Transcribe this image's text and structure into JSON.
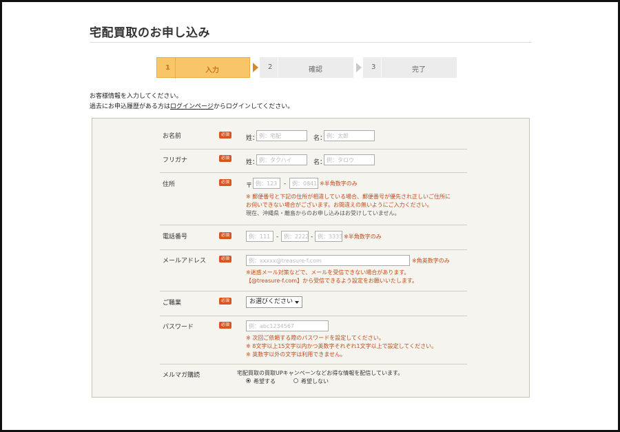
{
  "page": {
    "title": "宅配買取のお申し込み"
  },
  "steps": [
    {
      "num": "1",
      "label": "入力"
    },
    {
      "num": "2",
      "label": "確認"
    },
    {
      "num": "3",
      "label": "完了"
    }
  ],
  "intro": {
    "line1": "お客様情報を入力してください。",
    "line2_pre": "過去にお申込履歴がある方は",
    "login_link": "ログインページ",
    "line2_post": "からログインしてください。"
  },
  "required_badge": "必須",
  "form": {
    "name": {
      "label": "お名前",
      "sei": "姓：",
      "sei_placeholder": "例：宅配",
      "mei": "名：",
      "mei_placeholder": "例：太郎"
    },
    "kana": {
      "label": "フリガナ",
      "sei": "姓：",
      "sei_placeholder": "例：タクハイ",
      "mei": "名：",
      "mei_placeholder": "例：タロウ"
    },
    "address": {
      "label": "住所",
      "postal_mark": "〒",
      "zip1_placeholder": "例：123",
      "dash": "-",
      "zip2_placeholder": "例：0841",
      "hint": "※半角数字のみ",
      "notes": [
        "※ 郵便番号と下記の住所が相違している場合、郵便番号が優先され正しいご住所に",
        "お伺いできない場合がございます。お間違えの無いようにご入力ください。"
      ],
      "note_plain": "現在、沖縄県・離島からのお申し込みはお受けしていません。"
    },
    "phone": {
      "label": "電話番号",
      "p1_placeholder": "例：111",
      "p2_placeholder": "例：2222",
      "p3_placeholder": "例：3333",
      "dash": "-",
      "hint": "※半角数字のみ"
    },
    "email": {
      "label": "メールアドレス",
      "placeholder": "例：xxxxx@treasure-f.com",
      "hint": "※角英数字のみ",
      "notes": [
        "※迷惑メール対策などで、メールを受信できない場合があります。",
        "【@treasure-f.com】から受信できるよう設定をお願いいたします。"
      ]
    },
    "job": {
      "label": "ご職業",
      "selected": "お選びください"
    },
    "password": {
      "label": "パスワード",
      "placeholder": "例：abc1234567",
      "notes": [
        "※ 次回ご依頼する際のパスワードを設定してください。",
        "※ 8文字以上15文字以内かつ英数字それぞれ1文字以上で設定してください。",
        "※ 英数字以外の文字は利用できません。"
      ]
    },
    "newsletter": {
      "label": "メルマガ購読",
      "desc": "宅配買取の買取UPキャンペーンなどお得な情報を配信しています。",
      "opt_yes": "希望する",
      "opt_no": "希望しない"
    }
  },
  "colors": {
    "accent": "#f8c568",
    "required": "#d9541e",
    "note": "#c24a1a",
    "form_bg": "#f5f4ee"
  }
}
